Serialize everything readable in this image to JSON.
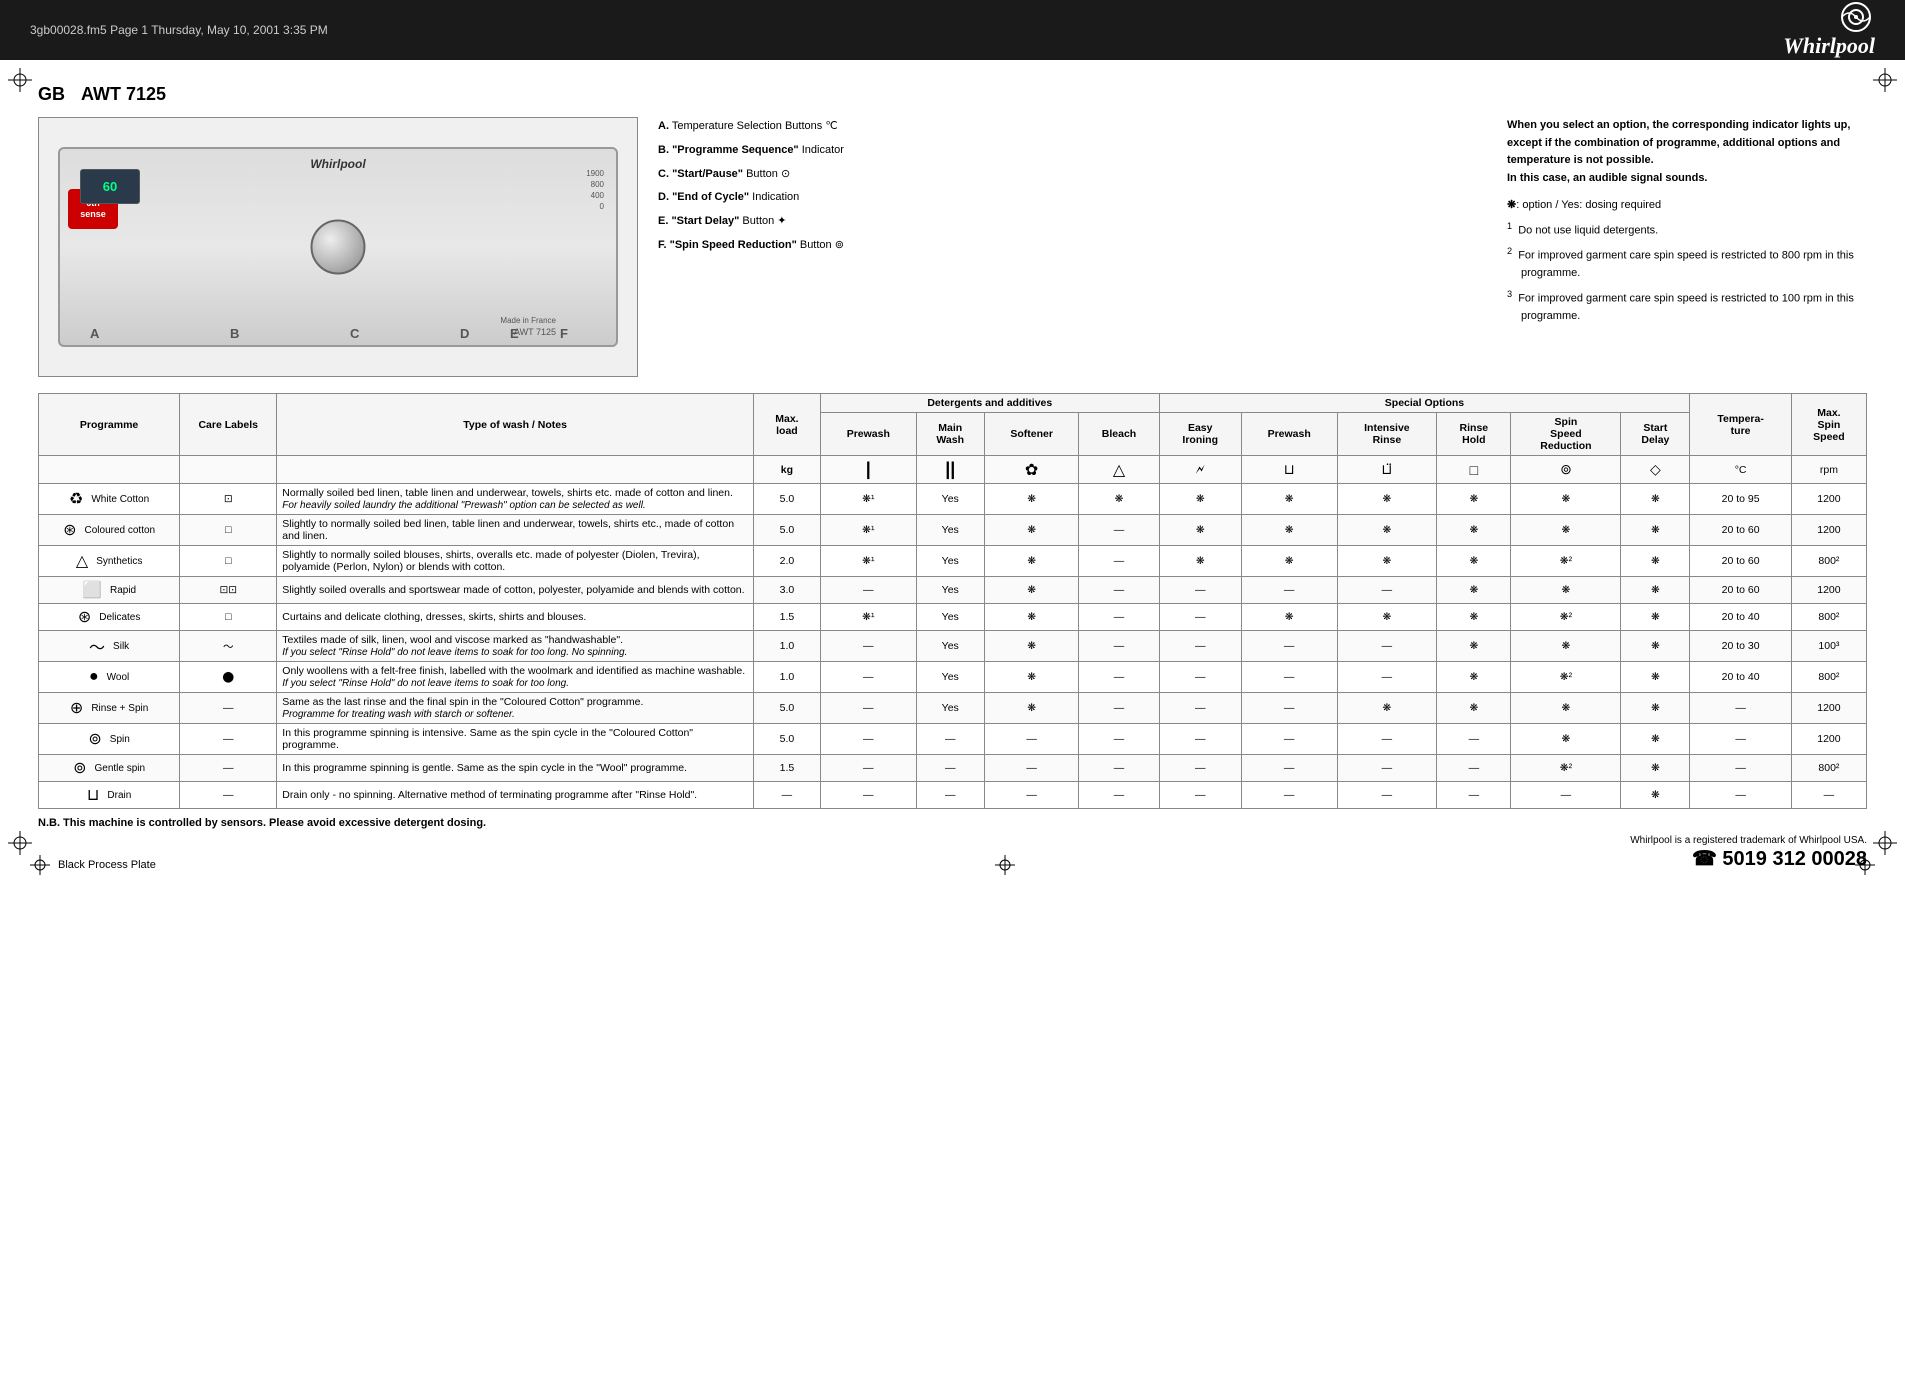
{
  "topbar": {
    "text": "3gb00028.fm5  Page 1  Thursday, May 10, 2001  3:35 PM",
    "logo": "Whirlpool"
  },
  "model": {
    "region": "GB",
    "model_number": "AWT 7125"
  },
  "legend": {
    "items": [
      {
        "key": "A.",
        "label": "Temperature Selection Buttons ℃"
      },
      {
        "key": "B.",
        "label": "\"Programme Sequence\" Indicator"
      },
      {
        "key": "C.",
        "label": "\"Start/Pause\" Button"
      },
      {
        "key": "D.",
        "label": "\"End of Cycle\" Indication"
      },
      {
        "key": "E.",
        "label": "\"Start Delay\" Button"
      },
      {
        "key": "F.",
        "label": "\"Spin Speed Reduction\" Button"
      }
    ]
  },
  "notes": {
    "main": "When you select an option, the corresponding indicator lights up, except if the combination of programme, additional options and temperature is not possible.\nIn this case, an audible signal sounds.",
    "footnote_symbol": "❋: option / Yes: dosing required",
    "footnotes": [
      "Do not use liquid detergents.",
      "For improved garment care spin speed is restricted to 800 rpm in this programme.",
      "For improved garment care spin speed is restricted to 100 rpm in this programme."
    ]
  },
  "table": {
    "headers": {
      "programme": "Programme",
      "care_labels": "Care Labels",
      "type_of_wash": "Type of wash / Notes",
      "max_load": "Max. load",
      "detergents_title": "Detergents and additives",
      "special_options_title": "Special Options",
      "prewash": "Prewash",
      "main_wash": "Main Wash",
      "softener": "Softener",
      "bleach": "Bleach",
      "easy_ironing": "Easy Ironing",
      "prewash2": "Prewash",
      "intensive_rinse": "Intensive Rinse",
      "rinse_hold": "Rinse Hold",
      "spin_speed_reduction": "Spin Speed Reduction",
      "start_delay": "Start Delay",
      "temperature": "Temperature",
      "max_spin_speed": "Max. Spin Speed",
      "kg": "kg",
      "celsius": "°C",
      "rpm": "rpm"
    },
    "rows": [
      {
        "programme": "White Cotton",
        "care_icon": "wash-full",
        "type_of_wash": "Normally soiled bed linen, table linen and underwear, towels, shirts etc. made of cotton and linen.",
        "type_note": "For heavily soiled laundry the additional \"Prewash\" option can be selected as well.",
        "max_load": "5.0",
        "prewash": "❋¹",
        "main_wash": "Yes",
        "softener": "❋",
        "bleach": "❋",
        "easy_ironing": "❋",
        "prewash2": "❋",
        "intensive_rinse": "❋",
        "rinse_hold": "❋",
        "spin_speed_reduction": "❋",
        "start_delay": "❋",
        "temperature": "20 to 95",
        "max_spin_speed": "1200"
      },
      {
        "programme": "Coloured cotton",
        "care_icon": "wash-outline",
        "type_of_wash": "Slightly to normally soiled bed linen, table linen and underwear, towels, shirts etc., made of cotton and linen.",
        "type_note": "",
        "max_load": "5.0",
        "prewash": "❋¹",
        "main_wash": "Yes",
        "softener": "❋",
        "bleach": "—",
        "easy_ironing": "❋",
        "prewash2": "❋",
        "intensive_rinse": "❋",
        "rinse_hold": "❋",
        "spin_speed_reduction": "❋",
        "start_delay": "❋",
        "temperature": "20 to 60",
        "max_spin_speed": "1200"
      },
      {
        "programme": "Synthetics",
        "care_icon": "wash-outline",
        "type_of_wash": "Slightly to normally soiled blouses, shirts, overalls etc. made of polyester (Diolen, Trevira), polyamide (Perlon, Nylon) or blends with cotton.",
        "type_note": "",
        "max_load": "2.0",
        "prewash": "❋¹",
        "main_wash": "Yes",
        "softener": "❋",
        "bleach": "—",
        "easy_ironing": "❋",
        "prewash2": "❋",
        "intensive_rinse": "❋",
        "rinse_hold": "❋",
        "spin_speed_reduction": "❋²",
        "start_delay": "❋",
        "temperature": "20 to 60",
        "max_spin_speed": "800²"
      },
      {
        "programme": "Rapid",
        "care_icon": "wash-outline-x2",
        "type_of_wash": "Slightly soiled overalls and sportswear made of cotton, polyester, polyamide and blends with cotton.",
        "type_note": "",
        "max_load": "3.0",
        "prewash": "—",
        "main_wash": "Yes",
        "softener": "❋",
        "bleach": "—",
        "easy_ironing": "—",
        "prewash2": "—",
        "intensive_rinse": "—",
        "rinse_hold": "❋",
        "spin_speed_reduction": "❋",
        "start_delay": "❋",
        "temperature": "20 to 60",
        "max_spin_speed": "1200"
      },
      {
        "programme": "Delicates",
        "care_icon": "wash-outline",
        "type_of_wash": "Curtains and delicate clothing, dresses, skirts, shirts and blouses.",
        "type_note": "",
        "max_load": "1.5",
        "prewash": "❋¹",
        "main_wash": "Yes",
        "softener": "❋",
        "bleach": "—",
        "easy_ironing": "—",
        "prewash2": "❋",
        "intensive_rinse": "❋",
        "rinse_hold": "❋",
        "spin_speed_reduction": "❋²",
        "start_delay": "❋",
        "temperature": "20 to 40",
        "max_spin_speed": "800²"
      },
      {
        "programme": "Silk",
        "care_icon": "silk-icon",
        "type_of_wash": "Textiles made of silk, linen, wool and viscose marked as \"handwashable\".",
        "type_note": "If you select \"Rinse Hold\" do not leave items to soak for too long. No spinning.",
        "max_load": "1.0",
        "prewash": "—",
        "main_wash": "Yes",
        "softener": "❋",
        "bleach": "—",
        "easy_ironing": "—",
        "prewash2": "—",
        "intensive_rinse": "—",
        "rinse_hold": "❋",
        "spin_speed_reduction": "❋",
        "start_delay": "❋",
        "temperature": "20 to 30",
        "max_spin_speed": "100³"
      },
      {
        "programme": "Wool",
        "care_icon": "wool-icon",
        "type_of_wash": "Only woollens with a felt-free finish, labelled with the woolmark and identified as machine washable.",
        "type_note": "If you select \"Rinse Hold\" do not leave items to soak for too long.",
        "max_load": "1.0",
        "prewash": "—",
        "main_wash": "Yes",
        "softener": "❋",
        "bleach": "—",
        "easy_ironing": "—",
        "prewash2": "—",
        "intensive_rinse": "—",
        "rinse_hold": "❋",
        "spin_speed_reduction": "❋²",
        "start_delay": "❋",
        "temperature": "20 to 40",
        "max_spin_speed": "800²"
      },
      {
        "programme": "Rinse + Spin",
        "care_icon": "—",
        "type_of_wash": "Same as the last rinse and the final spin in the \"Coloured Cotton\" programme.",
        "type_note": "Programme for treating wash with starch or softener.",
        "max_load": "5.0",
        "prewash": "—",
        "main_wash": "Yes",
        "softener": "❋",
        "bleach": "—",
        "easy_ironing": "—",
        "prewash2": "—",
        "intensive_rinse": "❋",
        "rinse_hold": "❋",
        "spin_speed_reduction": "❋",
        "start_delay": "❋",
        "temperature": "—",
        "max_spin_speed": "1200"
      },
      {
        "programme": "Spin",
        "care_icon": "—",
        "type_of_wash": "In this programme spinning is intensive. Same as the spin cycle in the \"Coloured Cotton\" programme.",
        "type_note": "",
        "max_load": "5.0",
        "prewash": "—",
        "main_wash": "—",
        "softener": "—",
        "bleach": "—",
        "easy_ironing": "—",
        "prewash2": "—",
        "intensive_rinse": "—",
        "rinse_hold": "—",
        "spin_speed_reduction": "❋",
        "start_delay": "❋",
        "temperature": "—",
        "max_spin_speed": "1200"
      },
      {
        "programme": "Gentle spin",
        "care_icon": "—",
        "type_of_wash": "In this programme spinning is gentle. Same as the spin cycle in the \"Wool\" programme.",
        "type_note": "",
        "max_load": "1.5",
        "prewash": "—",
        "main_wash": "—",
        "softener": "—",
        "bleach": "—",
        "easy_ironing": "—",
        "prewash2": "—",
        "intensive_rinse": "—",
        "rinse_hold": "—",
        "spin_speed_reduction": "❋²",
        "start_delay": "❋",
        "temperature": "—",
        "max_spin_speed": "800²"
      },
      {
        "programme": "Drain",
        "care_icon": "—",
        "type_of_wash": "Drain only - no spinning. Alternative method of terminating programme after \"Rinse Hold\".",
        "type_note": "",
        "max_load": "—",
        "prewash": "—",
        "main_wash": "—",
        "softener": "—",
        "bleach": "—",
        "easy_ironing": "—",
        "prewash2": "—",
        "intensive_rinse": "—",
        "rinse_hold": "—",
        "spin_speed_reduction": "—",
        "start_delay": "❋",
        "temperature": "—",
        "max_spin_speed": "—"
      }
    ]
  },
  "bottom_note": "N.B. This machine is controlled by sensors. Please avoid excessive detergent dosing.",
  "trademark": "Whirlpool is a registered trademark of Whirlpool USA.",
  "barcode_text": "☎ 5019 312 00028",
  "bottom_plate": "Black Process Plate"
}
